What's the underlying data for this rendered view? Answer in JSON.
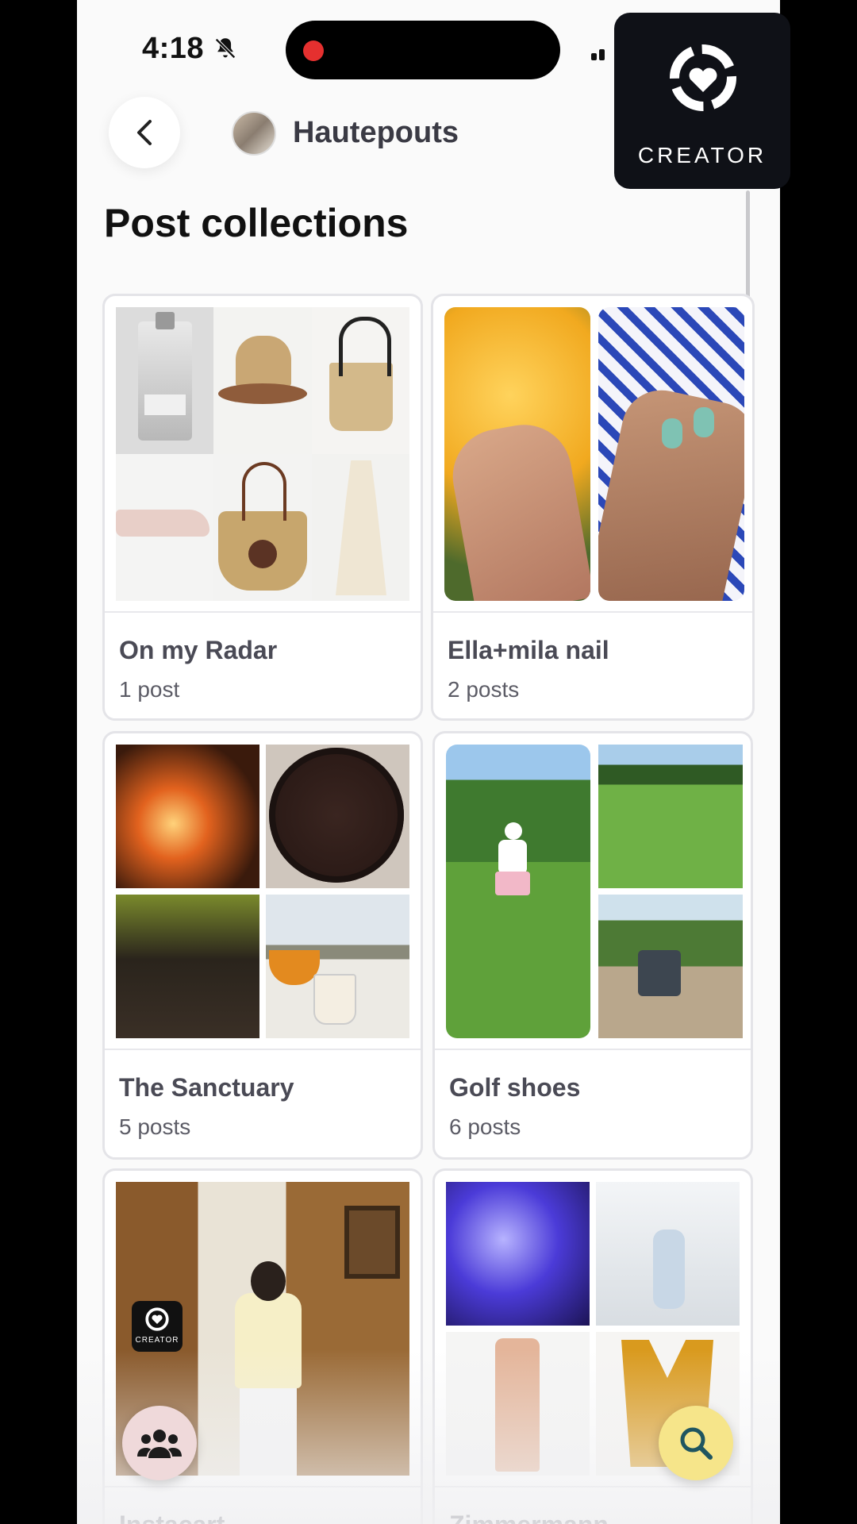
{
  "status_bar": {
    "time": "4:18"
  },
  "creator_badge": {
    "label": "CREATOR"
  },
  "header": {
    "profile_name": "Hautepouts"
  },
  "page": {
    "title": "Post collections"
  },
  "collections": [
    {
      "title": "On my Radar",
      "count": "1 post"
    },
    {
      "title": "Ella+mila nail",
      "count": "2 posts"
    },
    {
      "title": "The Sanctuary",
      "count": "5 posts"
    },
    {
      "title": "Golf shoes",
      "count": "6 posts"
    },
    {
      "title": "Instacart",
      "count": ""
    },
    {
      "title": "Zimmermann",
      "count": ""
    }
  ],
  "mini_badge": {
    "label": "CREATOR"
  },
  "colors": {
    "accent_search": "#f6e58a",
    "accent_users": "#efd9da",
    "badge_bg": "#0f1117"
  },
  "icons": [
    "bell-slash-icon",
    "back-chevron-icon",
    "creator-logo-icon",
    "users-icon",
    "search-icon"
  ]
}
